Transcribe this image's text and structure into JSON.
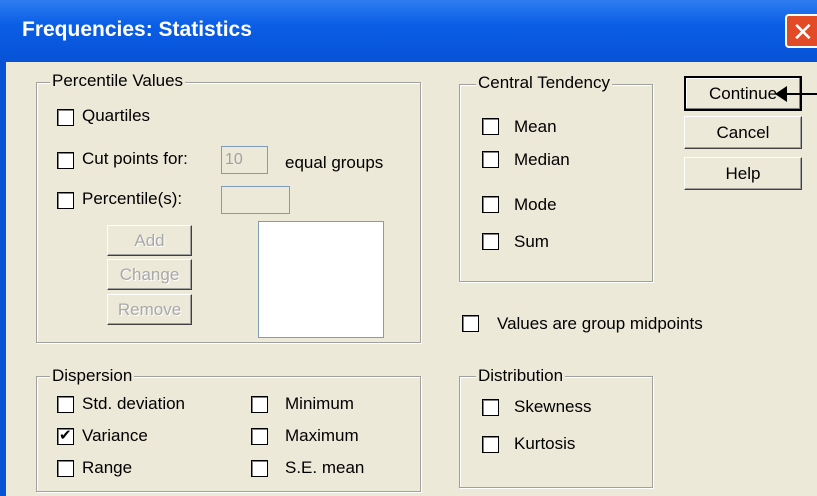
{
  "window": {
    "title": "Frequencies: Statistics"
  },
  "percentile_values": {
    "label": "Percentile Values",
    "quartiles": {
      "label": "Quartiles",
      "checked": false
    },
    "cut_points": {
      "label": "Cut points for:",
      "value": "10",
      "suffix": "equal groups",
      "checked": false
    },
    "percentiles": {
      "label": "Percentile(s):",
      "value": "",
      "checked": false
    },
    "buttons": {
      "add": "Add",
      "change": "Change",
      "remove": "Remove"
    }
  },
  "central_tendency": {
    "label": "Central Tendency",
    "items": [
      {
        "label": "Mean",
        "checked": false
      },
      {
        "label": "Median",
        "checked": false
      },
      {
        "label": "Mode",
        "checked": false
      },
      {
        "label": "Sum",
        "checked": false
      }
    ]
  },
  "dialog_buttons": {
    "continue": "Continue",
    "cancel": "Cancel",
    "help": "Help"
  },
  "group_midpoints": {
    "label": "Values are group midpoints",
    "checked": false
  },
  "dispersion": {
    "label": "Dispersion",
    "items": [
      {
        "label": "Std. deviation",
        "checked": false
      },
      {
        "label": "Minimum",
        "checked": false
      },
      {
        "label": "Variance",
        "checked": true
      },
      {
        "label": "Maximum",
        "checked": false
      },
      {
        "label": "Range",
        "checked": false
      },
      {
        "label": "S.E. mean",
        "checked": false
      }
    ]
  },
  "distribution": {
    "label": "Distribution",
    "items": [
      {
        "label": "Skewness",
        "checked": false
      },
      {
        "label": "Kurtosis",
        "checked": false
      }
    ]
  },
  "colors": {
    "titlebar": "#0852d6",
    "face": "#ece9d8",
    "close": "#e34a26"
  }
}
